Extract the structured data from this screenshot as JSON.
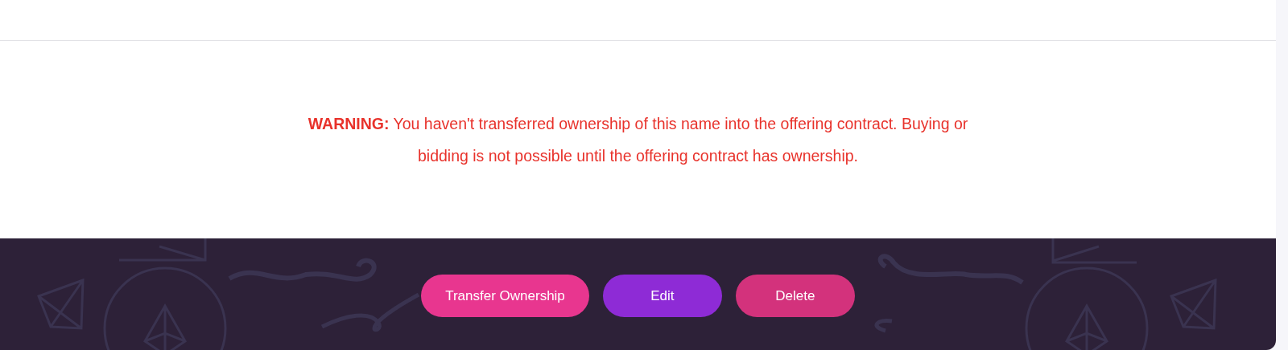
{
  "warning": {
    "text": "**WARNING:** You haven't transferred ownership of this name into the offering contract. Buying or bidding is not possible until the offering contract has ownership."
  },
  "buttons": [
    {
      "label": "Transfer Ownership",
      "color": "#e8368f"
    },
    {
      "label": "Edit",
      "color": "#8e2bd6"
    },
    {
      "label": "Delete",
      "color": "#d3327c"
    }
  ]
}
